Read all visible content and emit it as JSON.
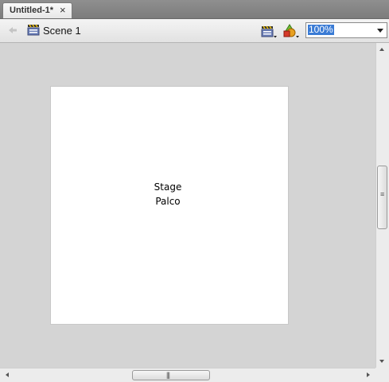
{
  "tab": {
    "title": "Untitled-1*",
    "close_glyph": "×"
  },
  "toolbar": {
    "back_icon": "arrow-left-icon",
    "scene_icon": "clapperboard-icon",
    "scene_label": "Scene 1",
    "edit_scene_icon": "clapperboard-dropdown-icon",
    "edit_symbols_icon": "shapes-dropdown-icon",
    "zoom_value": "100%"
  },
  "stage": {
    "line1": "Stage",
    "line2": "Palco",
    "background": "#ffffff"
  },
  "colors": {
    "pasteboard": "#d4d4d4",
    "selection": "#3a7bd5",
    "tab_bar": "#8f8f8f"
  }
}
